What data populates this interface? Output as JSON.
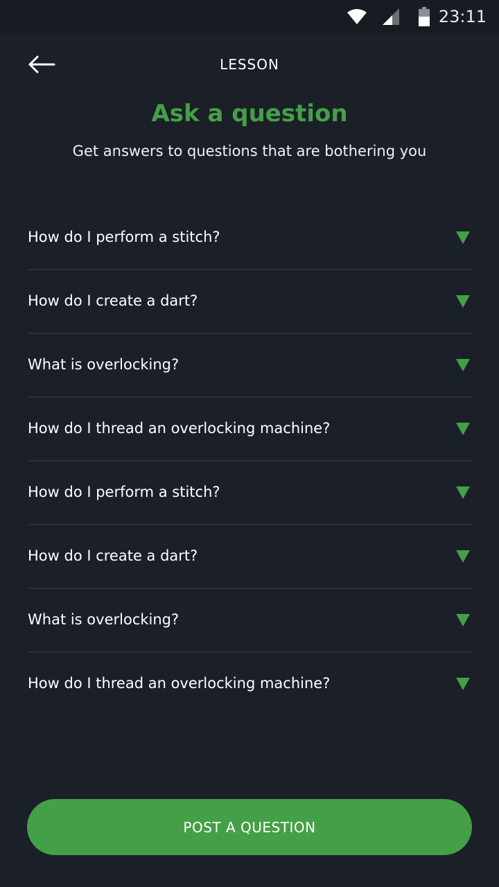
{
  "status_bar": {
    "time": "23:11",
    "icons": [
      "wifi-icon",
      "signal-icon",
      "battery-icon"
    ]
  },
  "topbar": {
    "title": "LESSON",
    "back_icon": "arrow-left-icon"
  },
  "header": {
    "title": "Ask a question",
    "subtitle": "Get answers to questions that are bothering you"
  },
  "questions": [
    {
      "label": "How do I perform a stitch?"
    },
    {
      "label": "How do I create a dart?"
    },
    {
      "label": "What is overlocking?"
    },
    {
      "label": "How do I thread an overlocking machine?"
    },
    {
      "label": "How do I perform a stitch?"
    },
    {
      "label": "How do I create a dart?"
    },
    {
      "label": "What is overlocking?"
    },
    {
      "label": "How do I thread an overlocking machine?"
    }
  ],
  "post_button": {
    "label": "POST A QUESTION"
  },
  "colors": {
    "background": "#1b1f27",
    "accent": "#43a047",
    "divider": "#2a2f37"
  }
}
